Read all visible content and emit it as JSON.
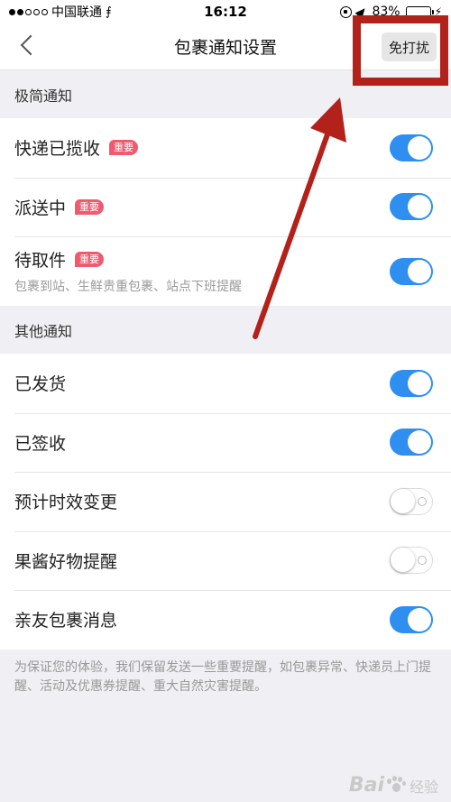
{
  "status_bar": {
    "carrier": "中国联通",
    "time": "16:12",
    "battery_percent": "83%",
    "battery_level": 0.83
  },
  "nav": {
    "title": "包裹通知设置",
    "dnd_label": "免打扰"
  },
  "sections": [
    {
      "title": "极简通知",
      "items": [
        {
          "label": "快递已揽收",
          "badge": "重要",
          "enabled": true
        },
        {
          "label": "派送中",
          "badge": "重要",
          "enabled": true
        },
        {
          "label": "待取件",
          "badge": "重要",
          "subtitle": "包裹到站、生鲜贵重包裹、站点下班提醒",
          "enabled": true
        }
      ]
    },
    {
      "title": "其他通知",
      "items": [
        {
          "label": "已发货",
          "enabled": true
        },
        {
          "label": "已签收",
          "enabled": true
        },
        {
          "label": "预计时效变更",
          "enabled": false
        },
        {
          "label": "果酱好物提醒",
          "enabled": false
        },
        {
          "label": "亲友包裹消息",
          "enabled": true
        }
      ]
    }
  ],
  "footer_note": "为保证您的体验，我们保留发送一些重要提醒，如包裹异常、快递员上门提醒、活动及优惠券提醒、重大自然灾害提醒。",
  "watermark": {
    "brand": "Bai",
    "suffix": "经验"
  },
  "colors": {
    "toggle_on": "#2e8ff0",
    "badge": "#f0596e",
    "annotation": "#b3211b"
  }
}
